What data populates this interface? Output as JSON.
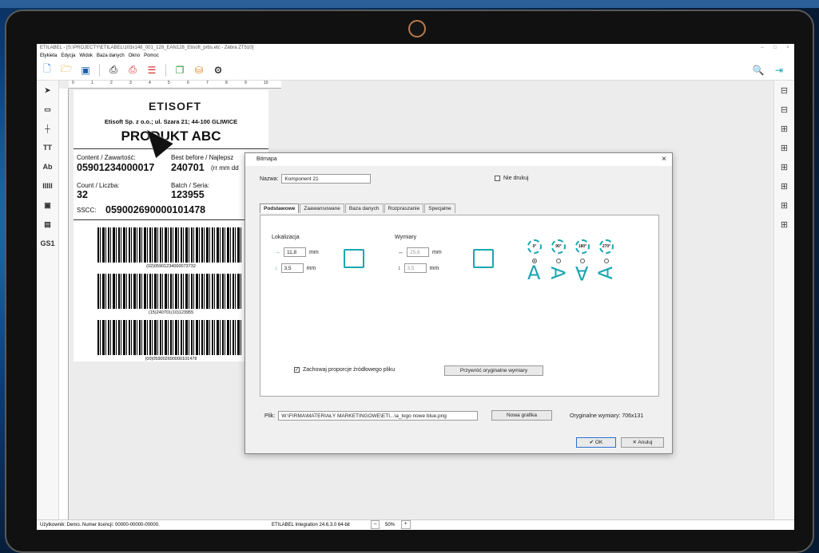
{
  "window": {
    "title": "ETILABEL - [S:\\PROJECTY\\ETILABEL\\103x148_001_128_EAN128_Etisoft_prbs.etc - Zebra ZT510]",
    "controls": [
      "–",
      "□",
      "×"
    ]
  },
  "menu": [
    "Etykieta",
    "Edycja",
    "Widok",
    "Baza danych",
    "Okno",
    "Pomoc"
  ],
  "toolbar": {
    "icons": [
      "new-file-icon",
      "open-folder-icon",
      "save-icon",
      "print-icon",
      "print-setup-icon",
      "print-list-icon",
      "copy-icon",
      "database-icon",
      "settings-icon"
    ],
    "right_icons": [
      "zoom-icon",
      "exit-icon"
    ]
  },
  "left_tools": [
    "➤",
    "▭",
    "┼",
    "TT",
    "Ab",
    "IIIII",
    "▣",
    "▤",
    "GS1"
  ],
  "right_tools": [
    "⊟",
    "⊟",
    "⊞",
    "⊞",
    "⊞",
    "⊞",
    "⊞",
    "⊞"
  ],
  "ruler_ticks": [
    "0",
    "1",
    "2",
    "3",
    "4",
    "5",
    "6",
    "7",
    "8",
    "9",
    "10"
  ],
  "label": {
    "logo": "ETISOFT",
    "address": "Etisoft Sp. z o.o.; ul. Szara 21; 44-100 GLIWICE",
    "product": "PRODUKT ABC",
    "content_label": "Content / Zawartość:",
    "content_value": "05901234000017",
    "best_label": "Best before / Najlepsz",
    "best_value": "240701",
    "best_suffix": "(rr mm dd",
    "count_label": "Count / Liczba:",
    "count_value": "32",
    "batch_label": "Batch / Seria:",
    "batch_value": "123955",
    "sscc_label": "SSCC:",
    "sscc_value": "059002690000101478",
    "bc1_text": "(02)05901234000073732",
    "bc2_text": "(15)240701(10)123955",
    "bc3_text": "(00)059002690000101478"
  },
  "dialog": {
    "title": "Bitmapa",
    "close": "×",
    "name_label": "Nazwa:",
    "name_value": "Komponent 21",
    "noprint_label": "Nie drukuj",
    "tabs": [
      "Podstawowe",
      "Zaawansowane",
      "Baza danych",
      "Rozpraszanie",
      "Specjalne"
    ],
    "location_title": "Lokalizacja",
    "loc_x": "11,8",
    "loc_y": "3,5",
    "unit": "mm",
    "size_title": "Wymiary",
    "size_w": "25,6",
    "size_h": "3,5",
    "rotations": [
      "0°",
      "90°",
      "180°",
      "270°"
    ],
    "keep_ratio_label": "Zachowaj proporcje źródłowego pliku",
    "restore_button": "Przywróć oryginalne wymiary",
    "file_label": "Plik:",
    "file_value": "W:\\FIRMA\\MATERIAŁY MARKETINGOWE\\ETI...\\a_logo nowe blue.png",
    "new_graphic_button": "Nowa grafika",
    "original_size_label": "Oryginalne wymiary: 706x131",
    "ok_button": "OK",
    "cancel_button": "Anuluj"
  },
  "status": {
    "user": "Użytkownik: Demo. Numer licencji: 00000-00000-00000.",
    "version": "ETILABEL Integration 24.6.3.0 64-bit",
    "zoom": "50%",
    "minus": "–",
    "plus": "+"
  }
}
